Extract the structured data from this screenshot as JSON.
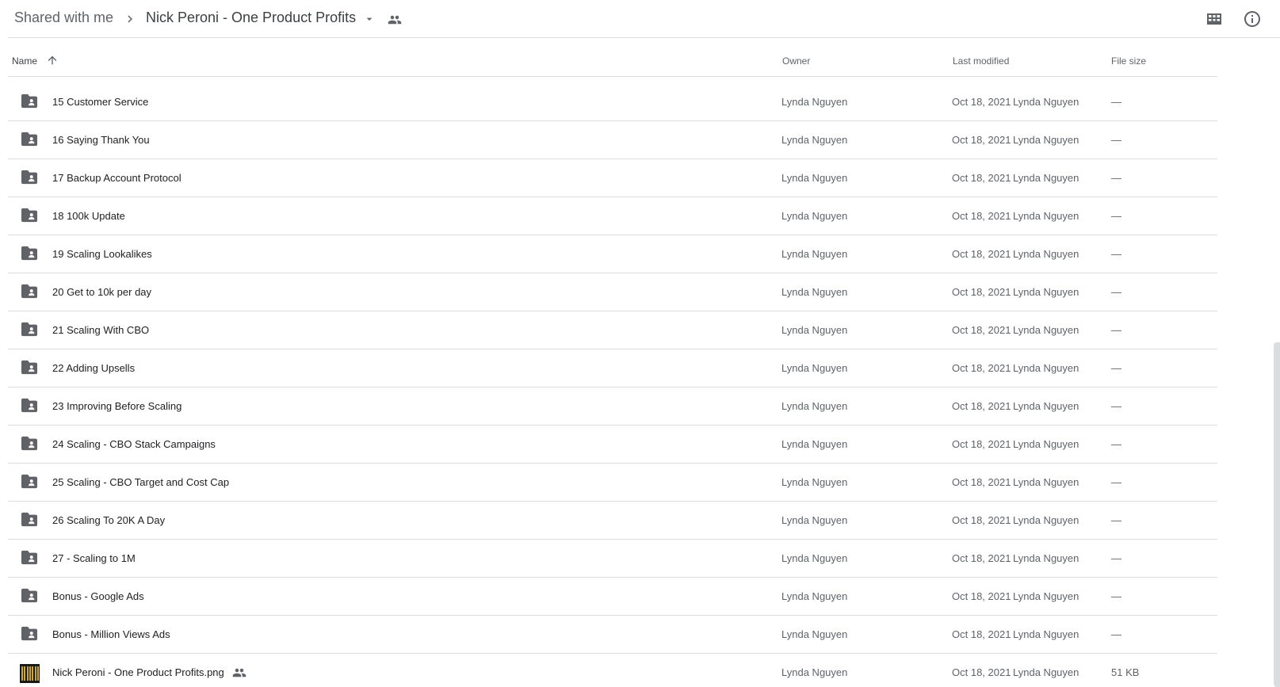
{
  "breadcrumb": {
    "root": "Shared with me",
    "current": "Nick Peroni - One Product Profits"
  },
  "icons": {
    "separator": "chevron-right-icon",
    "caret": "arrow-drop-down-icon",
    "shared": "people-icon",
    "grid": "grid-view-icon",
    "info": "info-icon",
    "sort": "arrow-upward-icon",
    "folder": "shared-folder-icon"
  },
  "columns": {
    "name": "Name",
    "owner": "Owner",
    "modified": "Last modified",
    "size": "File size"
  },
  "files": [
    {
      "name": "15 Customer Service",
      "type": "folder",
      "owner": "Lynda Nguyen",
      "modified_date": "Oct 18, 2021",
      "modified_by": "Lynda Nguyen",
      "size": "—"
    },
    {
      "name": "16 Saying Thank You",
      "type": "folder",
      "owner": "Lynda Nguyen",
      "modified_date": "Oct 18, 2021",
      "modified_by": "Lynda Nguyen",
      "size": "—"
    },
    {
      "name": "17 Backup Account Protocol",
      "type": "folder",
      "owner": "Lynda Nguyen",
      "modified_date": "Oct 18, 2021",
      "modified_by": "Lynda Nguyen",
      "size": "—"
    },
    {
      "name": "18 100k Update",
      "type": "folder",
      "owner": "Lynda Nguyen",
      "modified_date": "Oct 18, 2021",
      "modified_by": "Lynda Nguyen",
      "size": "—"
    },
    {
      "name": "19 Scaling Lookalikes",
      "type": "folder",
      "owner": "Lynda Nguyen",
      "modified_date": "Oct 18, 2021",
      "modified_by": "Lynda Nguyen",
      "size": "—"
    },
    {
      "name": "20 Get to 10k per day",
      "type": "folder",
      "owner": "Lynda Nguyen",
      "modified_date": "Oct 18, 2021",
      "modified_by": "Lynda Nguyen",
      "size": "—"
    },
    {
      "name": "21 Scaling With CBO",
      "type": "folder",
      "owner": "Lynda Nguyen",
      "modified_date": "Oct 18, 2021",
      "modified_by": "Lynda Nguyen",
      "size": "—"
    },
    {
      "name": "22 Adding Upsells",
      "type": "folder",
      "owner": "Lynda Nguyen",
      "modified_date": "Oct 18, 2021",
      "modified_by": "Lynda Nguyen",
      "size": "—"
    },
    {
      "name": "23 Improving Before Scaling",
      "type": "folder",
      "owner": "Lynda Nguyen",
      "modified_date": "Oct 18, 2021",
      "modified_by": "Lynda Nguyen",
      "size": "—"
    },
    {
      "name": "24 Scaling - CBO Stack Campaigns",
      "type": "folder",
      "owner": "Lynda Nguyen",
      "modified_date": "Oct 18, 2021",
      "modified_by": "Lynda Nguyen",
      "size": "—"
    },
    {
      "name": "25 Scaling - CBO Target and Cost Cap",
      "type": "folder",
      "owner": "Lynda Nguyen",
      "modified_date": "Oct 18, 2021",
      "modified_by": "Lynda Nguyen",
      "size": "—"
    },
    {
      "name": "26 Scaling To 20K A Day",
      "type": "folder",
      "owner": "Lynda Nguyen",
      "modified_date": "Oct 18, 2021",
      "modified_by": "Lynda Nguyen",
      "size": "—"
    },
    {
      "name": "27 - Scaling to 1M",
      "type": "folder",
      "owner": "Lynda Nguyen",
      "modified_date": "Oct 18, 2021",
      "modified_by": "Lynda Nguyen",
      "size": "—"
    },
    {
      "name": "Bonus - Google Ads",
      "type": "folder",
      "owner": "Lynda Nguyen",
      "modified_date": "Oct 18, 2021",
      "modified_by": "Lynda Nguyen",
      "size": "—"
    },
    {
      "name": "Bonus - Million Views Ads",
      "type": "folder",
      "owner": "Lynda Nguyen",
      "modified_date": "Oct 18, 2021",
      "modified_by": "Lynda Nguyen",
      "size": "—"
    },
    {
      "name": "Nick Peroni - One Product Profits.png",
      "type": "image",
      "shared": true,
      "owner": "Lynda Nguyen",
      "modified_date": "Oct 18, 2021",
      "modified_by": "Lynda Nguyen",
      "size": "51 KB"
    }
  ],
  "colors": {
    "icon": "#5f6368",
    "divider": "#dadce0",
    "text": "#202124",
    "muted": "#5f6368"
  }
}
